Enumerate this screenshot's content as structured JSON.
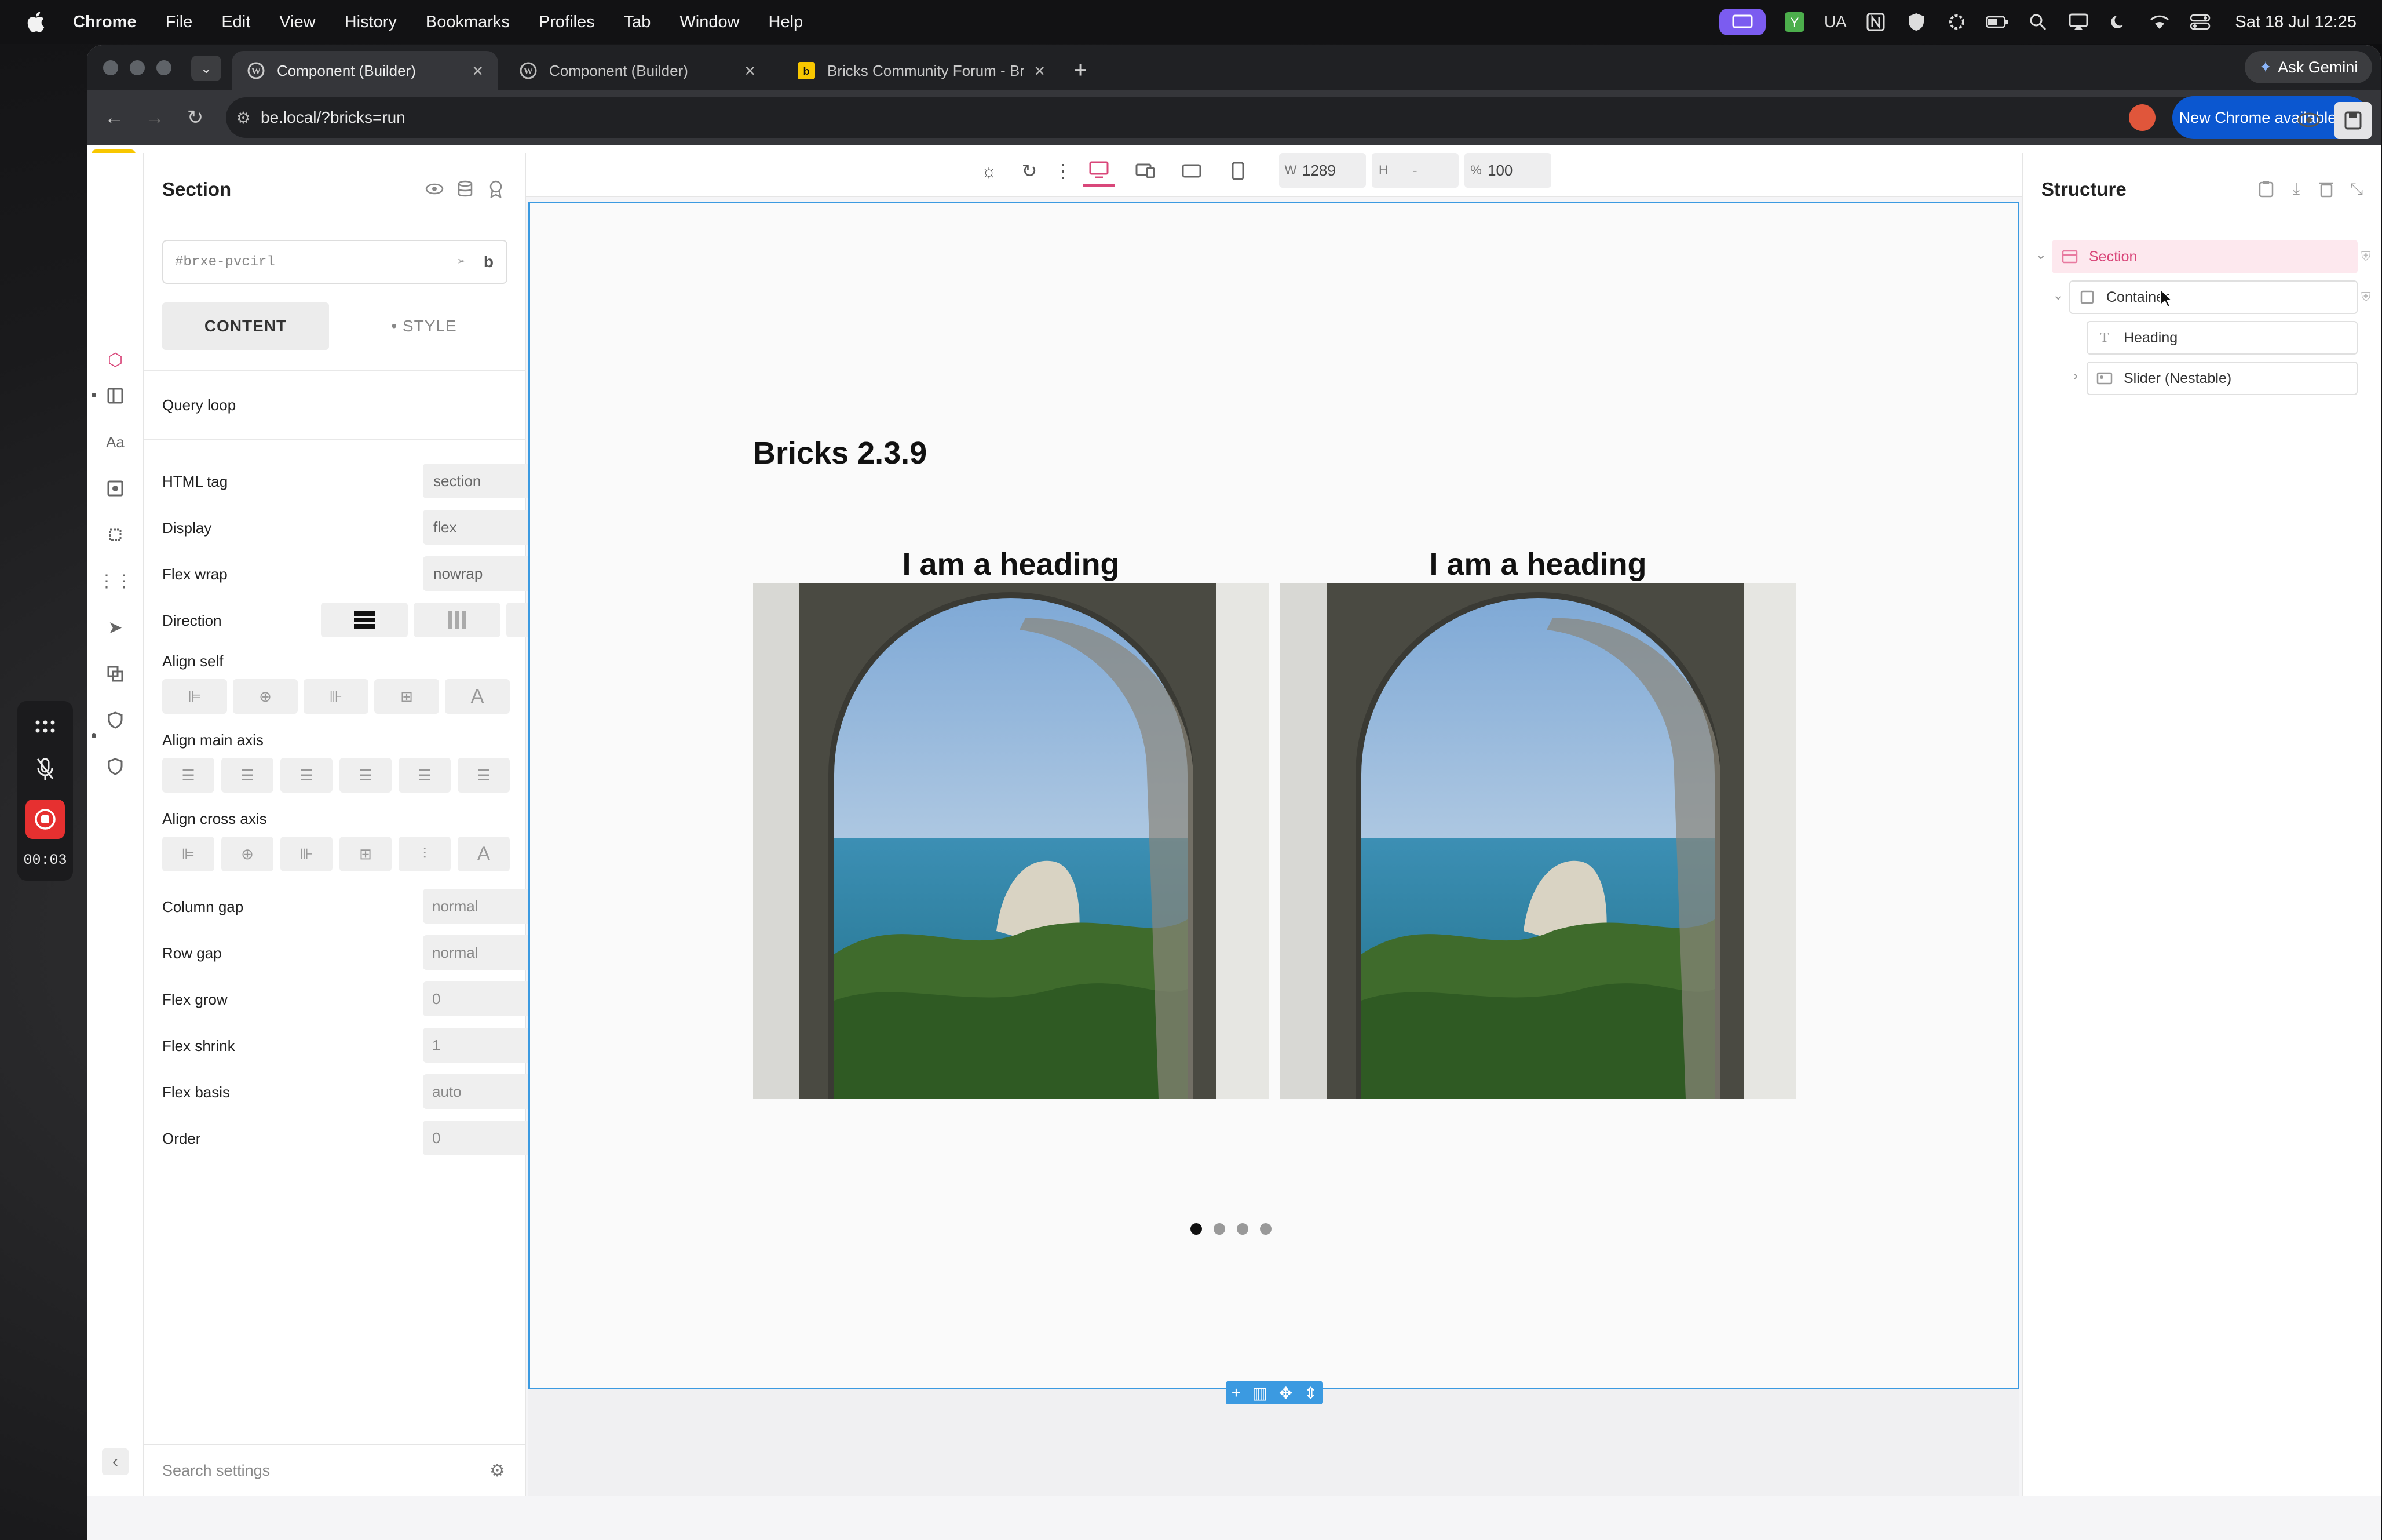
{
  "menubar": {
    "items": [
      "Chrome",
      "File",
      "Edit",
      "View",
      "History",
      "Bookmarks",
      "Profiles",
      "Tab",
      "Window",
      "Help"
    ],
    "status_ua": "UA",
    "clock": "Sat 18 Jul  12:25"
  },
  "browser": {
    "tabs": [
      {
        "label": "Component (Builder)",
        "active": true
      },
      {
        "label": "Component (Builder)",
        "active": false
      },
      {
        "label": "Bricks Community Forum - Br",
        "active": false
      }
    ],
    "url": "be.local/?bricks=run",
    "ask_gemini": "Ask Gemini",
    "new_chrome": "New Chrome available"
  },
  "topbar": {
    "logo": "b",
    "width_label": "W",
    "width_value": "1289",
    "height_label": "H",
    "height_value": "-",
    "zoom_label": "%",
    "zoom_value": "100"
  },
  "settings_panel": {
    "title": "Section",
    "css_id": "#brxe-pvcirl",
    "css_id_brand": "b",
    "tabs": {
      "content": "CONTENT",
      "style": "• STYLE"
    },
    "query_loop": "Query loop",
    "fields": {
      "html_tag": {
        "label": "HTML tag",
        "value": "section"
      },
      "display": {
        "label": "Display",
        "value": "flex"
      },
      "flex_wrap": {
        "label": "Flex wrap",
        "value": "nowrap"
      },
      "direction": {
        "label": "Direction"
      },
      "align_self": {
        "label": "Align self"
      },
      "align_main": {
        "label": "Align main axis"
      },
      "align_cross": {
        "label": "Align cross axis"
      },
      "column_gap": {
        "label": "Column gap",
        "value": "normal"
      },
      "row_gap": {
        "label": "Row gap",
        "value": "normal"
      },
      "flex_grow": {
        "label": "Flex grow",
        "value": "0"
      },
      "flex_shrink": {
        "label": "Flex shrink",
        "value": "1"
      },
      "flex_basis": {
        "label": "Flex basis",
        "value": "auto"
      },
      "order": {
        "label": "Order",
        "value": "0"
      }
    },
    "search_placeholder": "Search settings"
  },
  "canvas": {
    "page_title": "Bricks 2.3.9",
    "slides": [
      {
        "heading": "I am a heading"
      },
      {
        "heading": "I am a heading"
      }
    ],
    "pagination_count": 4,
    "pagination_active": 1
  },
  "structure": {
    "title": "Structure",
    "nodes": [
      {
        "label": "Section",
        "icon": "section-icon"
      },
      {
        "label": "Container",
        "icon": "container-icon"
      },
      {
        "label": "Heading",
        "icon": "heading-icon"
      },
      {
        "label": "Slider (Nestable)",
        "icon": "slider-icon"
      }
    ]
  },
  "recorder": {
    "time": "00:03"
  },
  "colors": {
    "bricks_yellow": "#f8c700",
    "selection_blue": "#3b9ae1",
    "active_pink": "#d9477a",
    "record_red": "#e63030",
    "chrome_blue": "#0b57d0"
  }
}
